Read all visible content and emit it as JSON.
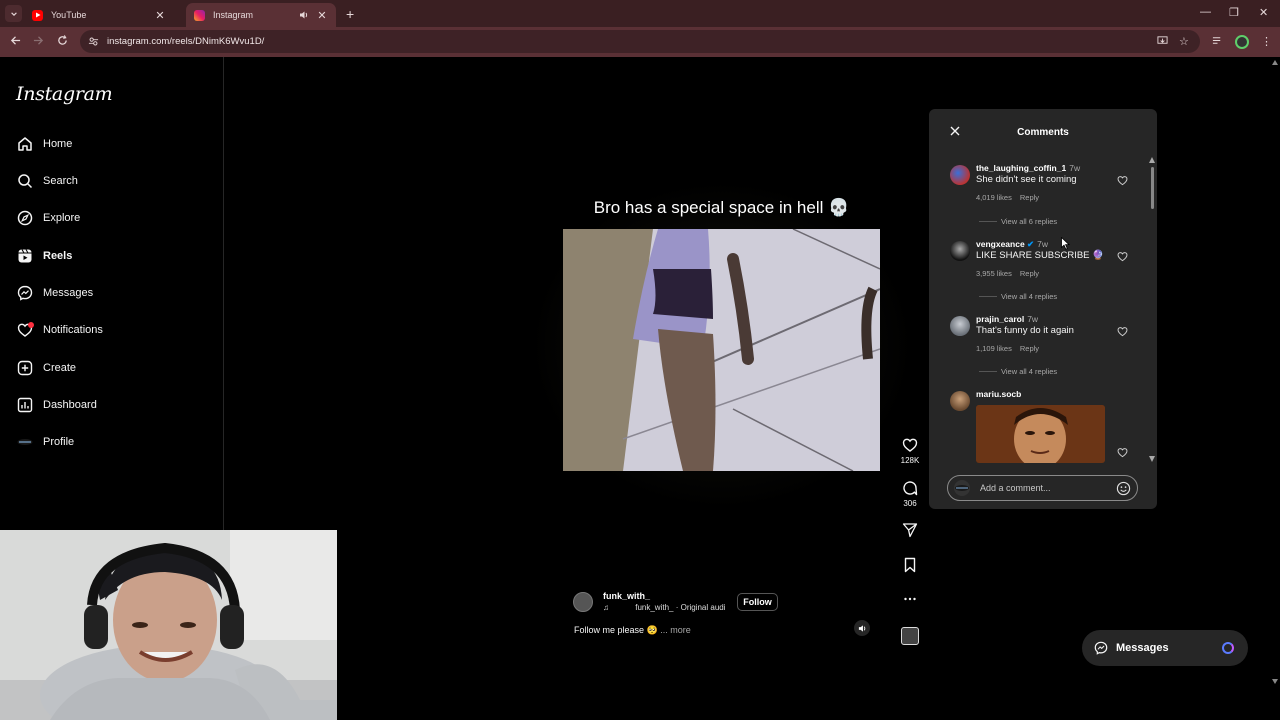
{
  "browser": {
    "tabs": [
      {
        "title": "YouTube",
        "active": false
      },
      {
        "title": "Instagram",
        "active": true
      }
    ],
    "url": "instagram.com/reels/DNimK6Wvu1D/"
  },
  "sidebar": {
    "logo": "Instagram",
    "items": [
      {
        "label": "Home",
        "icon": "home-icon"
      },
      {
        "label": "Search",
        "icon": "search-icon"
      },
      {
        "label": "Explore",
        "icon": "compass-icon"
      },
      {
        "label": "Reels",
        "icon": "reels-icon",
        "active": true
      },
      {
        "label": "Messages",
        "icon": "messenger-icon"
      },
      {
        "label": "Notifications",
        "icon": "heart-icon",
        "has_badge": true
      },
      {
        "label": "Create",
        "icon": "plus-square-icon"
      },
      {
        "label": "Dashboard",
        "icon": "dashboard-icon"
      },
      {
        "label": "Profile",
        "icon": "avatar"
      }
    ]
  },
  "reel": {
    "caption_overlay": "Bro has a special space in hell 💀",
    "likes": "128K",
    "comments_count": "306",
    "author": "funk_with_",
    "audio": "funk_with_ · Original audi",
    "follow_label": "Follow",
    "description": "Follow me please 🥺",
    "more_label": "... more"
  },
  "comments_panel": {
    "title": "Comments",
    "comments": [
      {
        "user": "the_laughing_coffin_1",
        "time": "7w",
        "text": "She didn't see it coming",
        "likes": "4,019 likes",
        "reply": "Reply",
        "replies": "View all 6 replies",
        "verified": false
      },
      {
        "user": "vengxeance",
        "time": "7w",
        "text": "LIKE SHARE SUBSCRIBE 🔮",
        "likes": "3,955 likes",
        "reply": "Reply",
        "replies": "View all 4 replies",
        "verified": true
      },
      {
        "user": "prajin_carol",
        "time": "7w",
        "text": "That's funny do it again",
        "likes": "1,109 likes",
        "reply": "Reply",
        "replies": "View all 4 replies",
        "verified": false
      },
      {
        "user": "mariu.socb",
        "time": "",
        "text": "",
        "likes": "",
        "reply": "",
        "replies": "",
        "verified": false
      }
    ],
    "input_placeholder": "Add a comment..."
  },
  "messages_pill": {
    "label": "Messages"
  },
  "colors": {
    "tab_bar": "#3a1f22",
    "address_bar": "#5a3035",
    "panel": "#262626",
    "badge": "#ff3040",
    "verified": "#0095f6"
  }
}
